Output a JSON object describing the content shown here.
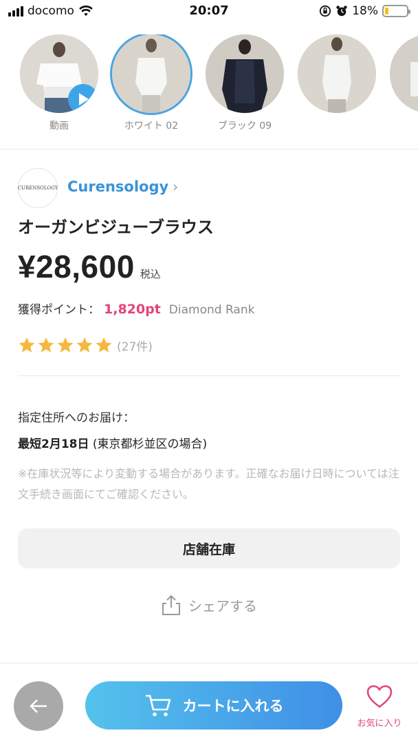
{
  "status_bar": {
    "carrier": "docomo",
    "time": "20:07",
    "battery": "18%",
    "battery_level": 0.18,
    "icons": [
      "signal-icon",
      "wifi-icon",
      "orientation-lock-icon",
      "alarm-icon",
      "battery-icon"
    ]
  },
  "thumbnails": [
    {
      "label": "動画",
      "selected": false,
      "has_play": true
    },
    {
      "label": "ホワイト 02",
      "selected": true,
      "has_play": false
    },
    {
      "label": "ブラック 09",
      "selected": false,
      "has_play": false
    },
    {
      "label": "",
      "selected": false,
      "has_play": false
    },
    {
      "label": "",
      "selected": false,
      "has_play": false
    }
  ],
  "brand": {
    "logo_text": "CURENSOLOGY",
    "name": "Curensology",
    "chevron": "›"
  },
  "product": {
    "title": "オーガンビジューブラウス",
    "price": "¥28,600",
    "tax_label": "税込",
    "points_label": "獲得ポイント：",
    "points_value": "1,820pt",
    "rank": "Diamond Rank",
    "rating": 5,
    "review_count": "(27件)"
  },
  "delivery": {
    "label": "指定住所へのお届け：",
    "date_bold": "最短2月18日",
    "date_note": " (東京都杉並区の場合)",
    "note": "※在庫状況等により変動する場合があります。正確なお届け日時については注文手続き画面にてご確認ください。"
  },
  "actions": {
    "store_stock": "店舗在庫",
    "share": "シェアする",
    "add_to_cart": "カートに入れる",
    "favorite": "お気に入り"
  },
  "colors": {
    "accent_blue": "#3a93d8",
    "pink": "#e2447a",
    "star": "#f6b73c",
    "cart_gradient_start": "#55c2ec",
    "cart_gradient_end": "#3f8fe6"
  }
}
